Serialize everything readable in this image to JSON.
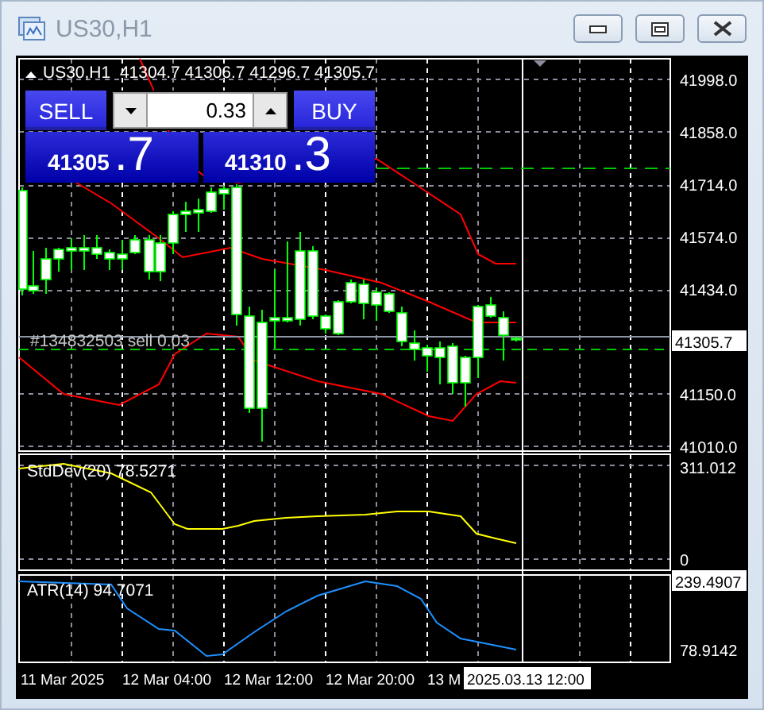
{
  "window": {
    "title": "US30,H1"
  },
  "chart": {
    "header": "US30,H1  41304.7 41306.7 41296.7 41305.7",
    "order_label": "#134832503 sell 0.03",
    "price_axis": [
      {
        "text": "41998.0",
        "kind": "tick"
      },
      {
        "text": "41858.0",
        "kind": "tick"
      },
      {
        "text": "41714.0",
        "kind": "tick"
      },
      {
        "text": "41574.0",
        "kind": "tick"
      },
      {
        "text": "41434.0",
        "kind": "tick"
      },
      {
        "text": "41305.7",
        "kind": "current"
      },
      {
        "text": "41150.0",
        "kind": "tick"
      },
      {
        "text": "41010.0",
        "kind": "tick"
      }
    ]
  },
  "trade_panel": {
    "sell_label": "SELL",
    "buy_label": "BUY",
    "lot": "0.33",
    "sell_price": {
      "main": "41305",
      "pips": ".7"
    },
    "buy_price": {
      "main": "41310",
      "pips": ".3"
    }
  },
  "indicators": [
    {
      "label": "StdDev(20) 78.5271",
      "axis": [
        {
          "text": "311.012",
          "kind": "tick"
        },
        {
          "text": "0",
          "kind": "tick"
        }
      ]
    },
    {
      "label": "ATR(14) 94.7071",
      "axis": [
        {
          "text": "239.4907",
          "kind": "current"
        },
        {
          "text": "78.9142",
          "kind": "tick"
        }
      ]
    }
  ],
  "time_axis": {
    "labels": [
      "11 Mar 2025",
      "12 Mar 04:00",
      "12 Mar 12:00",
      "12 Mar 20:00",
      "13 M"
    ],
    "crosshair": "2025.03.13 12:00"
  }
}
